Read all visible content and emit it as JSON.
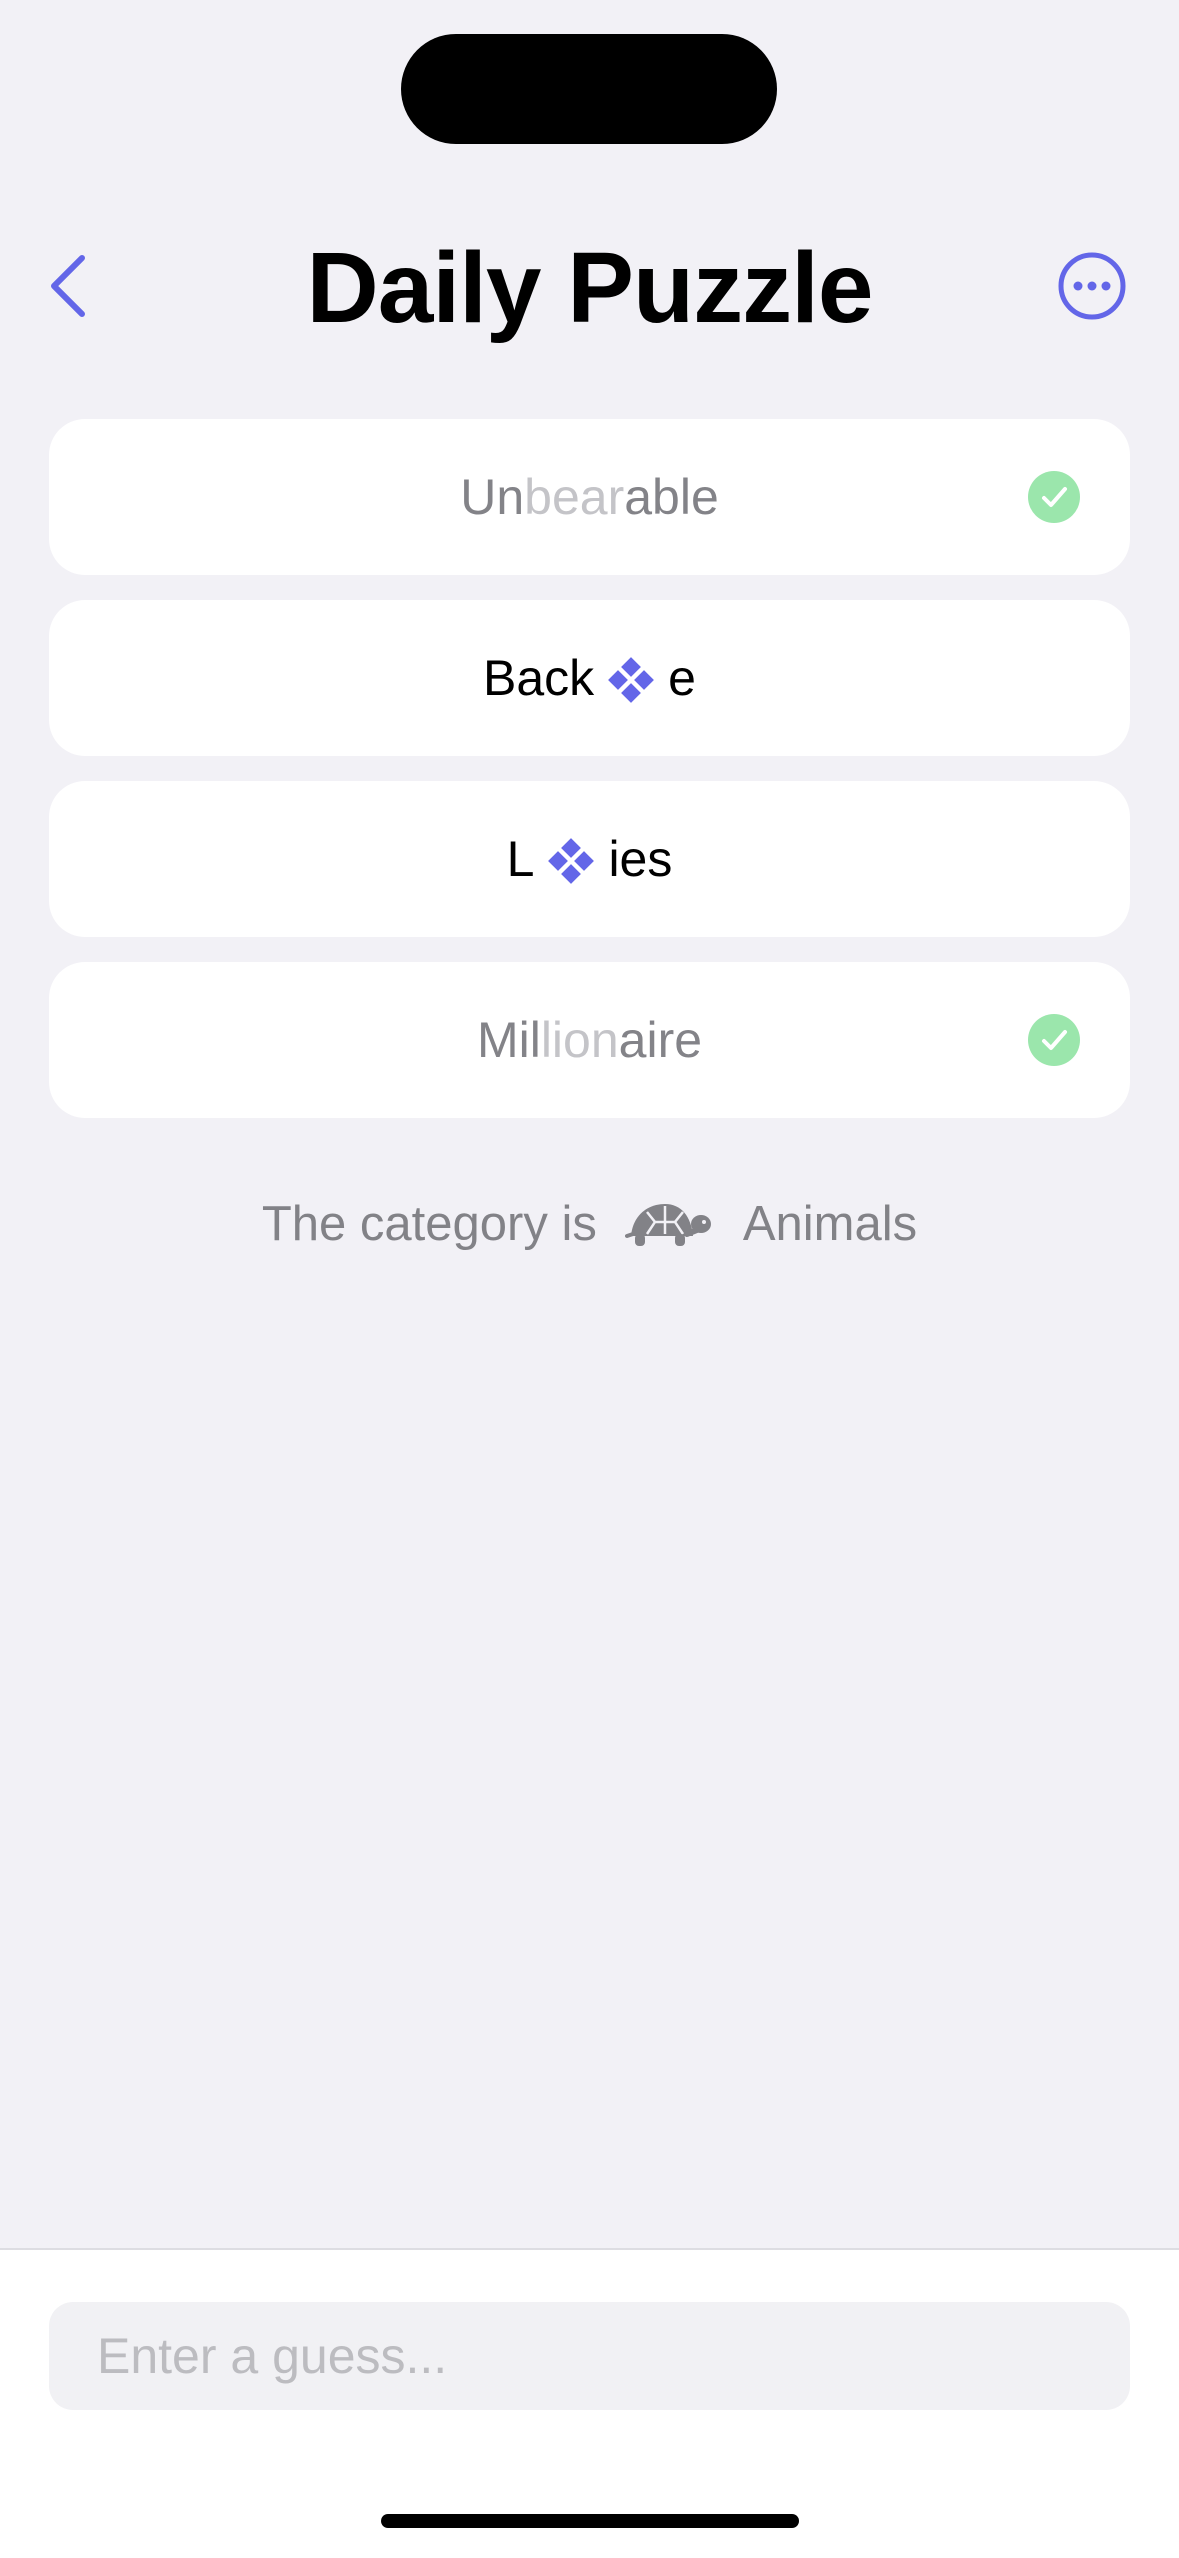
{
  "nav": {
    "title": "Daily Puzzle",
    "back_icon": "chevron-left-icon",
    "more_icon": "ellipsis-circle-icon",
    "accent": "#6366e8"
  },
  "clues": [
    {
      "state": "solved",
      "prefix": "Un",
      "hidden": "bear",
      "suffix": "able"
    },
    {
      "state": "open",
      "prefix": "Back",
      "suffix": "e"
    },
    {
      "state": "open",
      "prefix": "L",
      "suffix": "ies"
    },
    {
      "state": "solved",
      "prefix": "Mil",
      "hidden": "lion",
      "suffix": "aire"
    }
  ],
  "category": {
    "label": "The category is",
    "icon": "turtle-icon",
    "value": "Animals"
  },
  "guess": {
    "placeholder": "Enter a guess...",
    "value": ""
  },
  "colors": {
    "background": "#f2f1f6",
    "check": "#9be6ac",
    "gem": "#6366e8",
    "muted_text": "#838388",
    "hidden_text": "#c4c4c8"
  }
}
